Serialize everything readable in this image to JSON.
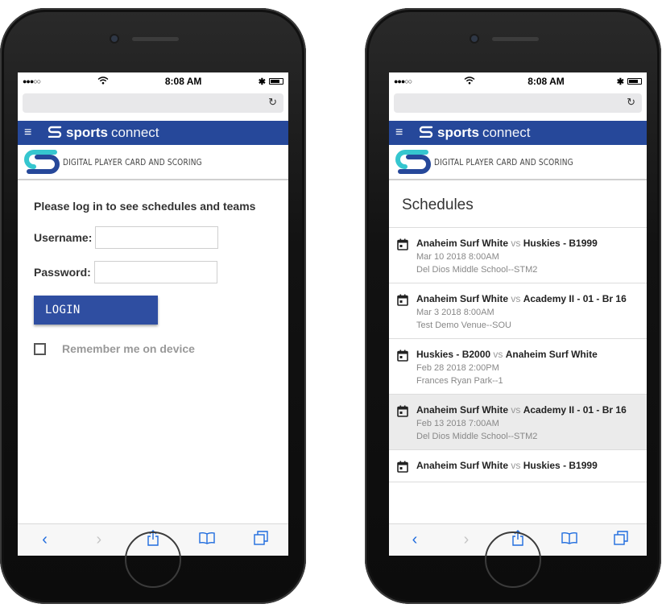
{
  "status": {
    "time": "8:08 AM"
  },
  "app": {
    "brand_bold": "sports",
    "brand_light": "connect",
    "subtitle": "DIGITAL PLAYER CARD AND SCORING"
  },
  "login": {
    "prompt": "Please log in to see schedules and teams",
    "username_label": "Username:",
    "password_label": "Password:",
    "login_button": "LOGIN",
    "remember_label": "Remember me on device"
  },
  "schedules": {
    "title": "Schedules",
    "games": [
      {
        "team_a": "Anaheim Surf White",
        "vs": "vs",
        "team_b": "Huskies - B1999",
        "datetime": "Mar 10 2018 8:00AM",
        "venue": "Del Dios Middle School--STM2"
      },
      {
        "team_a": "Anaheim Surf White",
        "vs": "vs",
        "team_b": "Academy II - 01 - Br 16",
        "datetime": "Mar 3 2018 8:00AM",
        "venue": "Test Demo Venue--SOU"
      },
      {
        "team_a": "Huskies - B2000",
        "vs": "vs",
        "team_b": "Anaheim Surf White",
        "datetime": "Feb 28 2018 2:00PM",
        "venue": "Frances Ryan Park--1"
      },
      {
        "team_a": "Anaheim Surf White",
        "vs": "vs",
        "team_b": "Academy II - 01 - Br 16",
        "datetime": "Feb 13 2018 7:00AM",
        "venue": "Del Dios Middle School--STM2"
      },
      {
        "team_a": "Anaheim Surf White",
        "vs": "vs",
        "team_b": "Huskies - B1999",
        "datetime": "",
        "venue": ""
      }
    ]
  },
  "toolbar": {
    "icons": [
      "back-icon",
      "forward-icon",
      "share-icon",
      "bookmarks-icon",
      "tabs-icon"
    ]
  },
  "colors": {
    "brand_blue": "#26489a",
    "button_blue": "#2f4ea1",
    "ios_blue": "#1f6cde",
    "logo_teal": "#35c6cf"
  }
}
